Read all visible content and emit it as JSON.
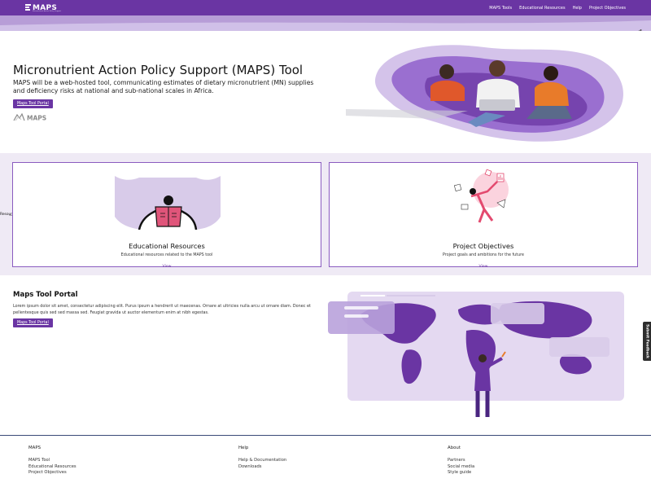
{
  "header": {
    "brand": "MAPS",
    "brand_subtitle": "Micronutrient Action Policy Support",
    "nav": [
      "MAPS Tools",
      "Educational Resources",
      "Help",
      "Project Objectives"
    ]
  },
  "hero": {
    "title": "Micronutrient Action Policy Support (MAPS) Tool",
    "description": "MAPS will be a web-hosted tool, communicating estimates of dietary micronutrient (MN) supplies and deficiency risks at national and sub-national scales in Africa.",
    "button": "Maps Tool Portal",
    "logo_alt": "MAPS"
  },
  "cards": [
    {
      "title": "Educational Resources",
      "description": "Educational resources related to the MAPS tool",
      "link": "View"
    },
    {
      "title": "Project Objectives",
      "description": "Project goals and ambitions for the future",
      "link": "View"
    }
  ],
  "stray_label": "Resou͟rcece",
  "portal": {
    "title": "Maps Tool Portal",
    "text": "Lorem ipsum dolor sit amet, consectetur adipiscing elit. Purus ipsum a hendrerit ut maecenas. Ornare at ultricies nulla arcu ut ornare diam. Donec et pellentesque quis sed sed massa sed. Feugiat gravida ut auctor elementum enim at nibh egestas.",
    "button": "Maps Tool Portal"
  },
  "feedback": "Submit Feedback",
  "footer": {
    "columns": [
      {
        "heading": "MAPS",
        "links": [
          "MAPS Tool",
          "Educational Resources",
          "Project Objectives"
        ]
      },
      {
        "heading": "Help",
        "links": [
          "Help & Documentation",
          "Downloads"
        ]
      },
      {
        "heading": "About",
        "links": [
          "Partners",
          "Social media",
          "Style guide"
        ]
      }
    ]
  },
  "colors": {
    "primary": "#6a35a3",
    "lavender": "#d0c0e8",
    "card_band": "#efeaf5",
    "card_border": "#8a5cc0",
    "footer_rule": "#3a4a78"
  },
  "icons": [
    "share-icon",
    "maps-logo-mark"
  ]
}
